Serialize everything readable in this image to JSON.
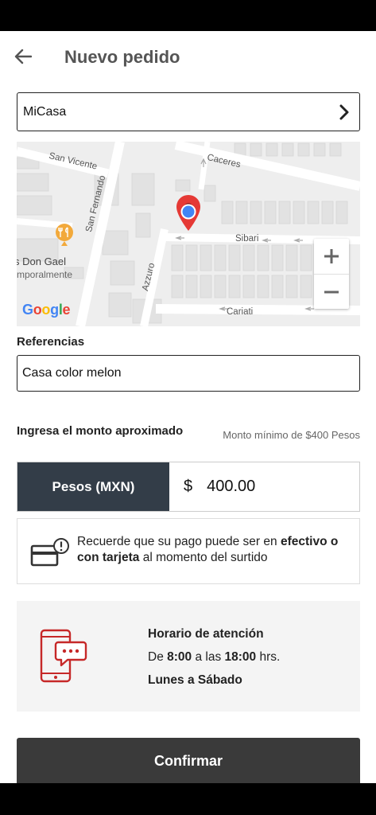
{
  "header": {
    "title": "Nuevo pedido",
    "back_icon": "arrow-left-icon"
  },
  "address": {
    "selected": "MiCasa",
    "chevron_icon": "chevron-right-icon"
  },
  "map": {
    "streets": {
      "san_vicente": "San Vicente",
      "caceres": "Caceres",
      "san_fernando": "San Fernando",
      "sibari": "Sibari",
      "azzuro": "Azzuro",
      "cariati": "Cariati"
    },
    "poi": {
      "name": "s Don Gael",
      "status": "mporalmente"
    },
    "zoom_in": "+",
    "zoom_out": "−",
    "provider": "Google",
    "pin_color": "#e53935",
    "location_dot_color": "#4285f4"
  },
  "references": {
    "label": "Referencias",
    "value": "Casa color melon"
  },
  "amount": {
    "label": "Ingresa el monto aproximado",
    "min_note": "Monto mínimo de $400 Pesos",
    "currency": "Pesos (MXN)",
    "symbol": "$",
    "value": "400.00",
    "currency_bg": "#333d48"
  },
  "payment": {
    "icon": "credit-card-alert-icon",
    "text_1": "Recuerde que su pago puede ser en ",
    "bold_1": "efectivo o con tarjeta",
    "text_2": " al momento del surtido"
  },
  "schedule": {
    "icon": "phone-chat-icon",
    "icon_color": "#c62828",
    "title": "Horario de atención",
    "pre": "De ",
    "from": "8:00",
    "mid": " a las ",
    "to": "18:00",
    "post": " hrs.",
    "days": "Lunes a Sábado"
  },
  "confirm": {
    "label": "Confirmar"
  }
}
